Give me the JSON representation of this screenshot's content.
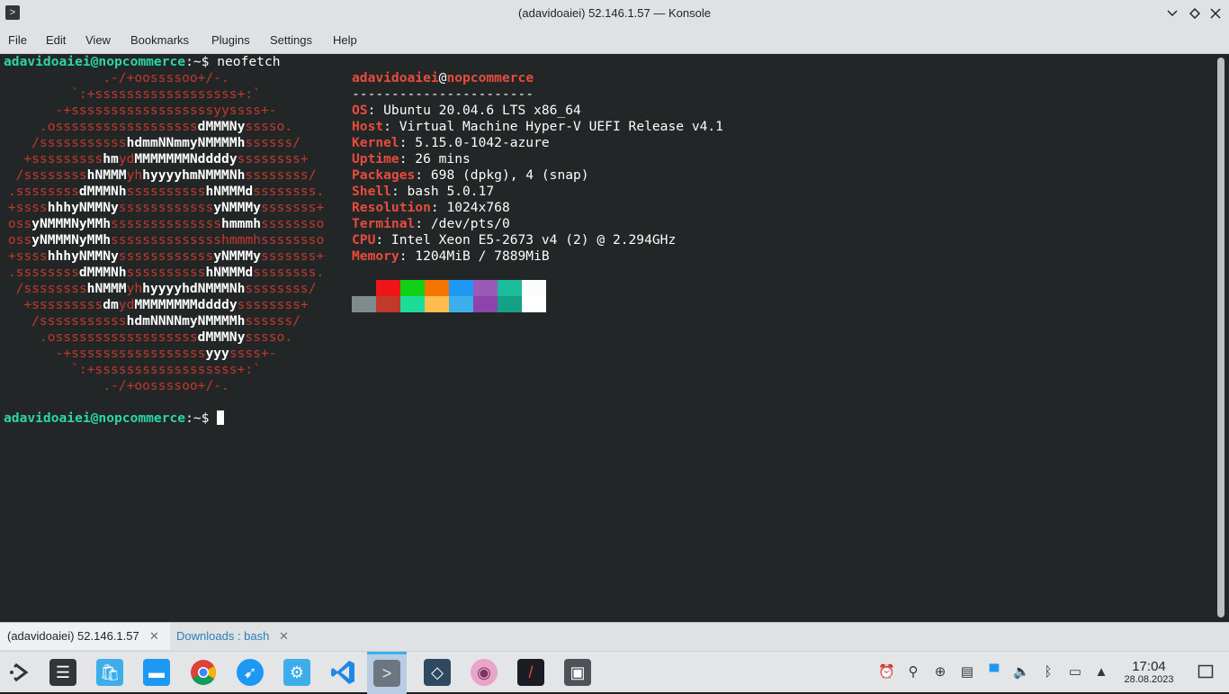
{
  "window": {
    "title": "(adavidoaiei) 52.146.1.57 — Konsole",
    "menu": [
      "File",
      "Edit",
      "View",
      "Bookmarks",
      "Plugins",
      "Settings",
      "Help"
    ]
  },
  "terminal": {
    "prompt_user": "adavidoaiei@nopcommerce",
    "prompt_path": ":~$",
    "command": " neofetch",
    "logo": [
      [
        [
          "r",
          "             .-/+oossssoo+/-."
        ]
      ],
      [
        [
          "r",
          "         `:+ssssssssssssssssss+:`"
        ]
      ],
      [
        [
          "r",
          "       -+ssssssssssssssssssyyssss+-"
        ]
      ],
      [
        [
          "r",
          "     .ossssssssssssssssss"
        ],
        [
          "wb",
          "dMMMNy"
        ],
        [
          "r",
          "sssso."
        ]
      ],
      [
        [
          "r",
          "    /sssssssssss"
        ],
        [
          "wb",
          "hdmmNNmmyNMMMMh"
        ],
        [
          "r",
          "ssssss/"
        ]
      ],
      [
        [
          "r",
          "   +sssssssss"
        ],
        [
          "wb",
          "hm"
        ],
        [
          "r",
          "yd"
        ],
        [
          "wb",
          "MMMMMMMNddddy"
        ],
        [
          "r",
          "ssssssss+"
        ]
      ],
      [
        [
          "r",
          "  /ssssssss"
        ],
        [
          "wb",
          "hNMMM"
        ],
        [
          "r",
          "yh"
        ],
        [
          "wb",
          "hyyyyhmNMMMNh"
        ],
        [
          "r",
          "ssssssss/"
        ]
      ],
      [
        [
          "r",
          " .ssssssss"
        ],
        [
          "wb",
          "dMMMNh"
        ],
        [
          "r",
          "ssssssssss"
        ],
        [
          "wb",
          "hNMMMd"
        ],
        [
          "r",
          "ssssssss."
        ]
      ],
      [
        [
          "r",
          " +ssss"
        ],
        [
          "wb",
          "hhhyNMMNy"
        ],
        [
          "r",
          "ssssssssssss"
        ],
        [
          "wb",
          "yNMMMy"
        ],
        [
          "r",
          "sssssss+"
        ]
      ],
      [
        [
          "r",
          " oss"
        ],
        [
          "wb",
          "yNMMMNyMMh"
        ],
        [
          "r",
          "ssssssssssssss"
        ],
        [
          "wb",
          "hmmmh"
        ],
        [
          "r",
          "ssssssso"
        ]
      ],
      [
        [
          "r",
          " oss"
        ],
        [
          "wb",
          "yNMMMNyMMh"
        ],
        [
          "r",
          "sssssssssssssshmmmhssssssso"
        ]
      ],
      [
        [
          "r",
          " +ssss"
        ],
        [
          "wb",
          "hhhyNMMNy"
        ],
        [
          "r",
          "ssssssssssss"
        ],
        [
          "wb",
          "yNMMMy"
        ],
        [
          "r",
          "sssssss+"
        ]
      ],
      [
        [
          "r",
          " .ssssssss"
        ],
        [
          "wb",
          "dMMMNh"
        ],
        [
          "r",
          "ssssssssss"
        ],
        [
          "wb",
          "hNMMMd"
        ],
        [
          "r",
          "ssssssss."
        ]
      ],
      [
        [
          "r",
          "  /ssssssss"
        ],
        [
          "wb",
          "hNMMM"
        ],
        [
          "r",
          "yh"
        ],
        [
          "wb",
          "hyyyyhdNMMMNh"
        ],
        [
          "r",
          "ssssssss/"
        ]
      ],
      [
        [
          "r",
          "   +sssssssss"
        ],
        [
          "wb",
          "dm"
        ],
        [
          "r",
          "yd"
        ],
        [
          "wb",
          "MMMMMMMMddddy"
        ],
        [
          "r",
          "ssssssss+"
        ]
      ],
      [
        [
          "r",
          "    /sssssssssss"
        ],
        [
          "wb",
          "hdmNNNNmyNMMMMh"
        ],
        [
          "r",
          "ssssss/"
        ]
      ],
      [
        [
          "r",
          "     .ossssssssssssssssss"
        ],
        [
          "wb",
          "dMMMNy"
        ],
        [
          "r",
          "sssso."
        ]
      ],
      [
        [
          "r",
          "       -+sssssssssssssssss"
        ],
        [
          "wb",
          "yyy"
        ],
        [
          "r",
          "ssss+-"
        ]
      ],
      [
        [
          "r",
          "         `:+ssssssssssssssssss+:`"
        ]
      ],
      [
        [
          "r",
          "             .-/+oossssoo+/-."
        ]
      ]
    ],
    "info_user": "adavidoaiei",
    "info_at": "@",
    "info_host": "nopcommerce",
    "separator": "-----------------------",
    "info": [
      {
        "key": "OS",
        "value": ": Ubuntu 20.04.6 LTS x86_64"
      },
      {
        "key": "Host",
        "value": ": Virtual Machine Hyper-V UEFI Release v4.1"
      },
      {
        "key": "Kernel",
        "value": ": 5.15.0-1042-azure"
      },
      {
        "key": "Uptime",
        "value": ": 26 mins"
      },
      {
        "key": "Packages",
        "value": ": 698 (dpkg), 4 (snap)"
      },
      {
        "key": "Shell",
        "value": ": bash 5.0.17"
      },
      {
        "key": "Resolution",
        "value": ": 1024x768"
      },
      {
        "key": "Terminal",
        "value": ": /dev/pts/0"
      },
      {
        "key": "CPU",
        "value": ": Intel Xeon E5-2673 v4 (2) @ 2.294GHz"
      },
      {
        "key": "Memory",
        "value": ": 1204MiB / 7889MiB"
      }
    ],
    "palette_row1": [
      "#232627",
      "#ed1515",
      "#11d116",
      "#f67400",
      "#1d99f3",
      "#9b59b6",
      "#1abc9c",
      "#fcfcfc"
    ],
    "palette_row2": [
      "#7f8c8d",
      "#c0392b",
      "#1cdc9a",
      "#fdbc4b",
      "#3daee9",
      "#8e44ad",
      "#16a085",
      "#ffffff"
    ]
  },
  "tabs": [
    {
      "label": "(adavidoaiei) 52.146.1.57",
      "active": true
    },
    {
      "label": "Downloads : bash",
      "active": false
    }
  ],
  "taskbar": {
    "apps": [
      {
        "name": "app-launcher",
        "icon": "kde-launcher-icon"
      },
      {
        "name": "system-settings",
        "icon": "settings-icon"
      },
      {
        "name": "discover",
        "icon": "store-icon"
      },
      {
        "name": "dolphin",
        "icon": "folder-icon"
      },
      {
        "name": "chrome",
        "icon": "chrome-icon"
      },
      {
        "name": "kdeconnect",
        "icon": "bird-icon"
      },
      {
        "name": "vm-manager",
        "icon": "cloud-gear-icon"
      },
      {
        "name": "vscode",
        "icon": "vscode-icon"
      },
      {
        "name": "konsole",
        "icon": "terminal-icon"
      },
      {
        "name": "mysql-workbench",
        "icon": "dolphin-db-icon"
      },
      {
        "name": "ksnip",
        "icon": "eye-icon"
      },
      {
        "name": "krita",
        "icon": "brush-icon"
      },
      {
        "name": "spectacle",
        "icon": "camera-icon"
      }
    ],
    "clock_time": "17:04",
    "clock_date": "28.08.2023"
  }
}
